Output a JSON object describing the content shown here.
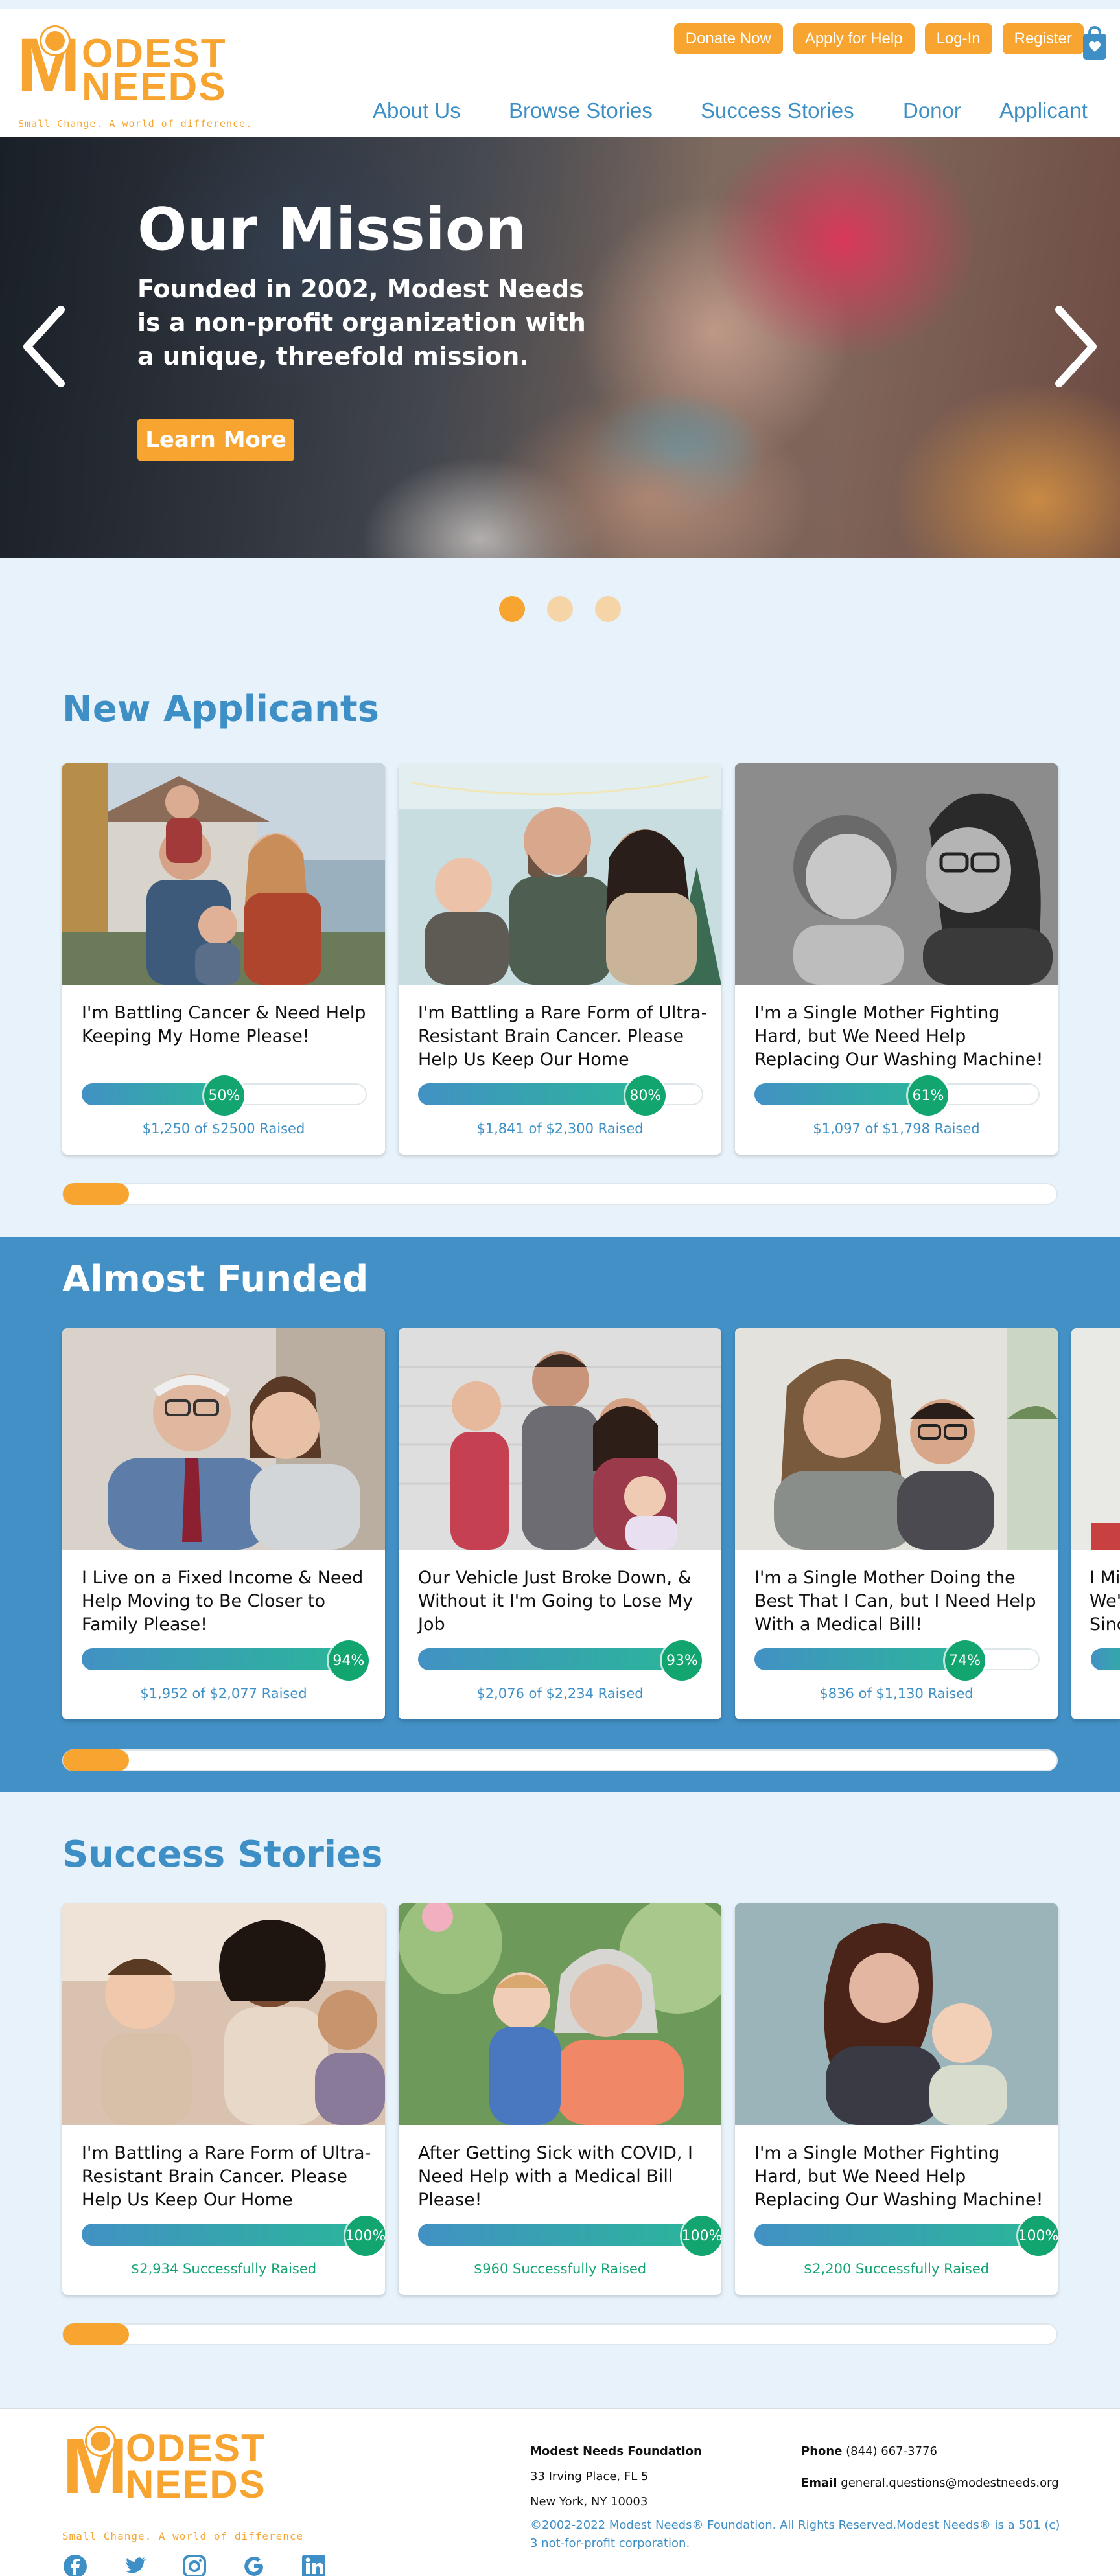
{
  "logo": {
    "m": "M",
    "line1": "ODEST",
    "line2": "NEEDS",
    "tagline": "Small Change. A world of difference."
  },
  "top_buttons": [
    "Donate Now",
    "Apply for Help",
    "Log-In",
    "Register"
  ],
  "nav": [
    "About Us",
    "Browse Stories",
    "Success Stories",
    "Donor",
    "Applicant"
  ],
  "hero": {
    "title": "Our Mission",
    "subtitle": "Founded in 2002, Modest Needs is a non-profit organization with a unique, threefold mission.",
    "button": "Learn More",
    "slides": 3,
    "active_slide": 1
  },
  "new_applicants": {
    "title": "New Applicants",
    "cards": [
      {
        "title": "I'm Battling Cancer & Need Help Keeping My Home Please!",
        "percent": 50,
        "percent_label": "50%",
        "raised": "$1,250 of $2500 Raised"
      },
      {
        "title": "I'm Battling a Rare Form of Ultra-Resistant Brain Cancer. Please Help Us Keep Our Home",
        "percent": 80,
        "percent_label": "80%",
        "raised": "$1,841 of $2,300 Raised"
      },
      {
        "title": "I'm a Single Mother Fighting Hard, but We Need Help Replacing Our Washing Machine!",
        "percent": 61,
        "percent_label": "61%",
        "raised": "$1,097 of $1,798 Raised"
      }
    ],
    "scroll_position": 0.05
  },
  "almost_funded": {
    "title": "Almost Funded",
    "cards": [
      {
        "title": "I Live on a Fixed Income & Need Help Moving to Be Closer to Family Please!",
        "percent": 94,
        "percent_label": "94%",
        "raised": "$1,952 of $2,077 Raised"
      },
      {
        "title": "Our Vehicle Just Broke Down, & Without it I'm Going to Lose My Job",
        "percent": 93,
        "percent_label": "93%",
        "raised": "$2,076 of $2,234 Raised"
      },
      {
        "title": "I'm a Single Mother Doing the Best That I Can, but I Need Help With a Medical Bill!",
        "percent": 74,
        "percent_label": "74%",
        "raised": "$836 of $1,130 Raised"
      },
      {
        "title": "I Mi We' Sinc",
        "percent": 90,
        "percent_label": "",
        "raised": ""
      }
    ],
    "scroll_position": 0.05
  },
  "success_stories": {
    "title": "Success Stories",
    "cards": [
      {
        "title": "I'm Battling a Rare Form of Ultra-Resistant Brain Cancer. Please Help Us Keep Our Home",
        "percent": 100,
        "percent_label": "100%",
        "raised": "$2,934 Successfully Raised"
      },
      {
        "title": "After Getting Sick with COVID, I Need Help with a Medical Bill Please!",
        "percent": 100,
        "percent_label": "100%",
        "raised": "$960 Successfully Raised"
      },
      {
        "title": "I'm a Single Mother Fighting Hard, but We Need Help Replacing Our Washing Machine!",
        "percent": 100,
        "percent_label": "100%",
        "raised": "$2,200 Successfully Raised"
      }
    ],
    "scroll_position": 0.05
  },
  "footer": {
    "org_name": "Modest Needs Foundation",
    "address1": "33 Irving Place, FL 5",
    "address2": "New York, NY 10003",
    "phone_label": "Phone",
    "phone": "(844) 667-3776",
    "email_label": "Email",
    "email": "general.questions@modestneeds.org",
    "copyright": "©2002-2022 Modest Needs® Foundation. All Rights Reserved.Modest Needs® is a 501 (c) 3 not-for-profit corporation.",
    "tagline": "Small Change. A world of difference",
    "socials": [
      "facebook-icon",
      "twitter-icon",
      "instagram-icon",
      "google-icon",
      "linkedin-icon"
    ]
  },
  "colors": {
    "brand_orange": "#f7a431",
    "brand_blue": "#3d8fc6",
    "band_blue": "#4290c5",
    "success_green": "#12a570",
    "page_bg": "#e8f2fa"
  }
}
